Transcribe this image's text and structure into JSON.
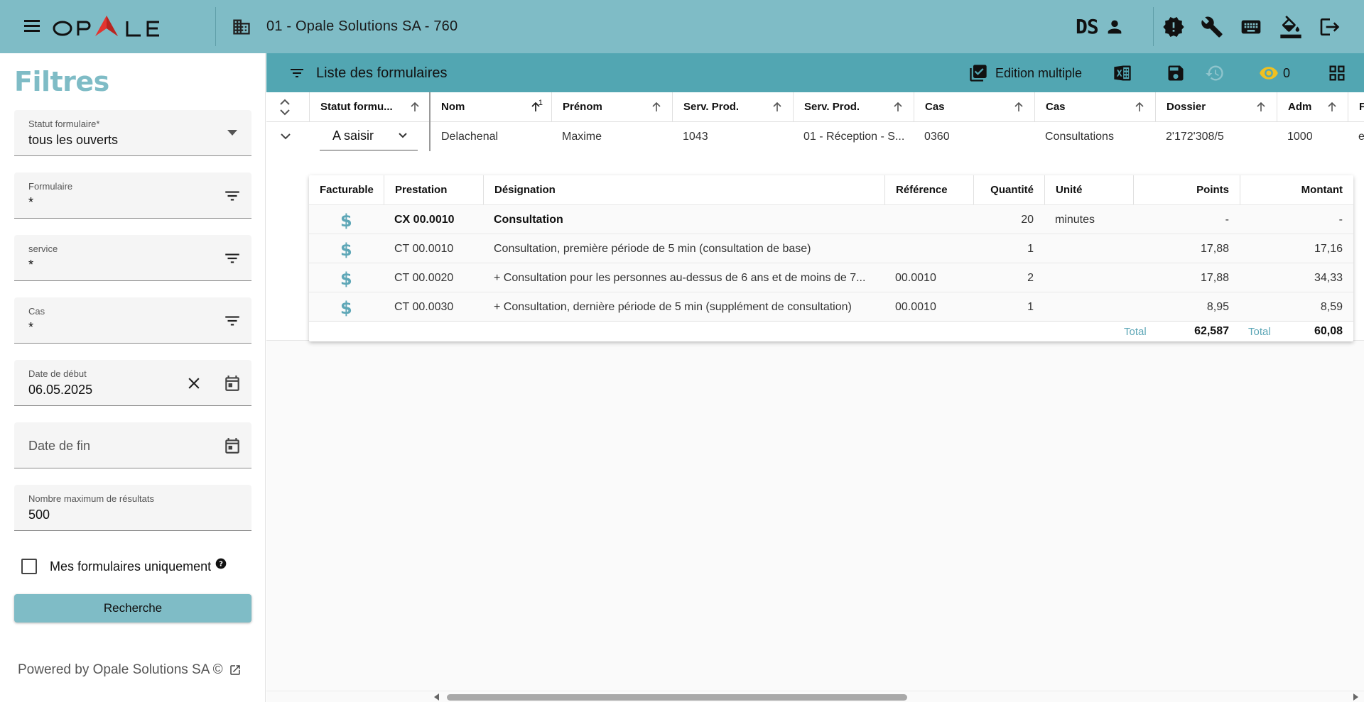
{
  "header": {
    "brand": "OPALE",
    "organization": "01 -  Opale Solutions SA - 760",
    "user_initials": "DS",
    "colors": {
      "topbar": "#7fbcc6",
      "brand_accent": "#e3342f"
    }
  },
  "sidebar": {
    "title": "Filtres",
    "fields": {
      "statut": {
        "label": "Statut formulaire*",
        "value": "tous les ouverts"
      },
      "formulaire": {
        "label": "Formulaire",
        "value": "*"
      },
      "service": {
        "label": "service",
        "value": "*"
      },
      "cas": {
        "label": "Cas",
        "value": "*"
      },
      "date_debut": {
        "label": "Date de début",
        "value": "06.05.2025"
      },
      "date_fin": {
        "placeholder": "Date de fin"
      },
      "max_results": {
        "label": "Nombre maximum de résultats",
        "value": "500"
      }
    },
    "checkbox_label": "Mes formulaires uniquement",
    "search_button": "Recherche",
    "powered_by": "Powered by Opale Solutions SA ©"
  },
  "main": {
    "list_title": "Liste des formulaires",
    "edit_multiple": "Edition multiple",
    "visible_count": "0",
    "columns": [
      {
        "label": "Statut formu..."
      },
      {
        "label": "Nom",
        "sort_index": "1"
      },
      {
        "label": "Prénom"
      },
      {
        "label": "Serv. Prod."
      },
      {
        "label": "Serv. Prod."
      },
      {
        "label": "Cas"
      },
      {
        "label": "Cas"
      },
      {
        "label": "Dossier"
      },
      {
        "label": "Adm"
      },
      {
        "label": "F"
      }
    ],
    "row": {
      "status": "A saisir",
      "nom": "Delachenal",
      "prenom": "Maxime",
      "serv_prod_code": "1043",
      "serv_prod_name": "01 - Réception - S...",
      "cas_code": "0360",
      "cas_name": "Consultations",
      "dossier": "2'172'308/5",
      "adm": "1000",
      "extra": "e"
    },
    "sub_table": {
      "columns": [
        "Facturable",
        "Prestation",
        "Désignation",
        "Référence",
        "Quantité",
        "Unité",
        "Points",
        "Montant"
      ],
      "rows": [
        {
          "prestation": "CX 00.0010",
          "designation": "Consultation",
          "reference": "",
          "quantite": "20",
          "unite": "minutes",
          "points": "-",
          "montant": "-"
        },
        {
          "prestation": "CT 00.0010",
          "designation": "Consultation, première période de 5 min (consultation de base)",
          "reference": "",
          "quantite": "1",
          "unite": "",
          "points": "17,88",
          "montant": "17,16"
        },
        {
          "prestation": "CT 00.0020",
          "designation": "+ Consultation pour les personnes au-dessus de 6 ans et de moins de 7...",
          "reference": "00.0010",
          "quantite": "2",
          "unite": "",
          "points": "17,88",
          "montant": "34,33"
        },
        {
          "prestation": "CT 00.0030",
          "designation": "+ Consultation, dernière période de 5 min (supplément de consultation)",
          "reference": "00.0010",
          "quantite": "1",
          "unite": "",
          "points": "8,95",
          "montant": "8,59"
        }
      ],
      "dollar_symbol": "$",
      "total_label": "Total",
      "total_points": "62,587",
      "total_montant": "60,08"
    }
  }
}
